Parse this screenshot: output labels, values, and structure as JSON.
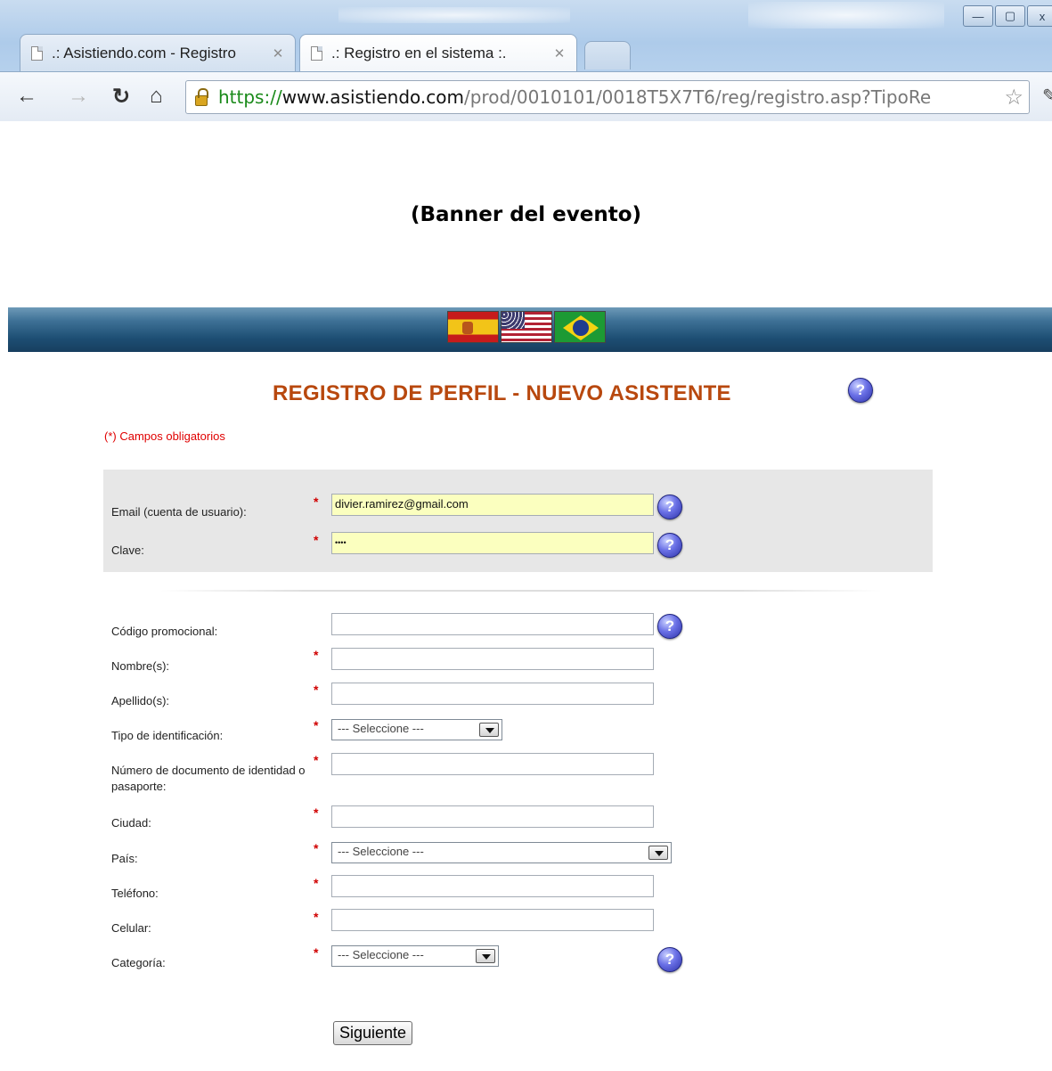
{
  "browser": {
    "tabs": [
      {
        "title": ".: Asistiendo.com - Registro",
        "active": false
      },
      {
        "title": ".: Registro en el sistema :.",
        "active": true
      }
    ],
    "url": {
      "protocol": "https://",
      "host": "www.asistiendo.com",
      "path": "/prod/0010101/0018T5X7T6/reg/registro.asp?TipoRe"
    },
    "window_buttons": {
      "minimize": "—",
      "maximize": "▢",
      "close": "x"
    }
  },
  "page": {
    "banner": "(Banner del evento)",
    "languages": [
      "Español",
      "English",
      "Português"
    ],
    "form_title": "REGISTRO DE PERFIL - NUEVO ASISTENTE",
    "required_note": "(*) Campos obligatorios",
    "required_mark": "*",
    "help_glyph": "?",
    "fields": {
      "email": {
        "label": "Email (cuenta de usuario):",
        "value": "divier.ramirez@gmail.com"
      },
      "password": {
        "label": "Clave:",
        "value": "••••"
      },
      "promo": {
        "label": "Código promocional:",
        "value": ""
      },
      "first_name": {
        "label": "Nombre(s):",
        "value": ""
      },
      "last_name": {
        "label": "Apellido(s):",
        "value": ""
      },
      "id_type": {
        "label": "Tipo de identificación:",
        "selected": "--- Seleccione ---"
      },
      "document": {
        "label": "Número de documento de identidad o pasaporte:",
        "value": ""
      },
      "city": {
        "label": "Ciudad:",
        "value": ""
      },
      "country": {
        "label": "País:",
        "selected": "--- Seleccione ---"
      },
      "phone": {
        "label": "Teléfono:",
        "value": ""
      },
      "mobile": {
        "label": "Celular:",
        "value": ""
      },
      "category": {
        "label": "Categoría:",
        "selected": "--- Seleccione ---"
      }
    },
    "submit_label": "Siguiente"
  },
  "colors": {
    "title": "#b8480e",
    "required": "#e00000",
    "highlight_field": "#fbffbf",
    "account_box": "#e7e7e7",
    "lang_bar": "#1d4e73",
    "secure_protocol": "#1a8a1a"
  }
}
